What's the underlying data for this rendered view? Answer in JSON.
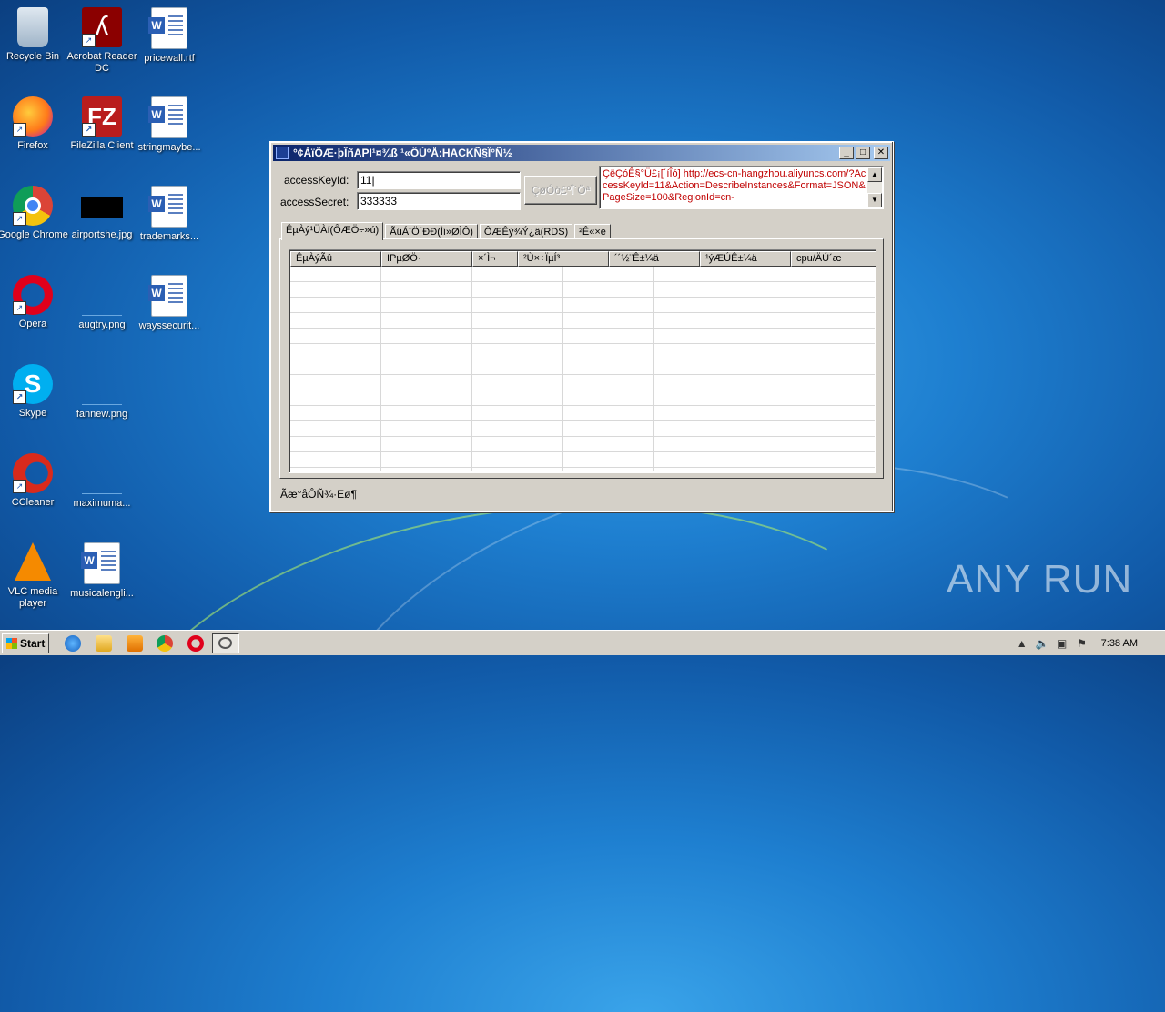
{
  "desktop": {
    "icons": [
      {
        "label": "Recycle Bin"
      },
      {
        "label": "Acrobat Reader DC"
      },
      {
        "label": "pricewall.rtf"
      },
      {
        "label": "Firefox"
      },
      {
        "label": "FileZilla Client"
      },
      {
        "label": "stringmaybe..."
      },
      {
        "label": "Google Chrome"
      },
      {
        "label": "airportshe.jpg"
      },
      {
        "label": "trademarks..."
      },
      {
        "label": "Opera"
      },
      {
        "label": "augtry.png"
      },
      {
        "label": "wayssecurit..."
      },
      {
        "label": "Skype"
      },
      {
        "label": "fannew.png"
      },
      {
        "label": "CCleaner"
      },
      {
        "label": "maximuma..."
      },
      {
        "label": "VLC media player"
      },
      {
        "label": "musicalengli..."
      }
    ]
  },
  "window": {
    "title": "°¢ÀïÔÆ·þÎñAPI¹¤¾ß ¹«ÖÚºÅ:HACKÑ§Ï°Ñ½",
    "access_key_label": "accessKeyId:",
    "access_key_value": "11|",
    "access_secret_label": "accessSecret:",
    "access_secret_value": "333333",
    "query_button": "ÇøÓò£ºÎ´Öª",
    "url_text": "ÇëÇóÊ§°Ü£¡[´íÎó] http://ecs-cn-hangzhou.aliyuncs.com/?AccessKeyId=11&Action=DescribeInstances&Format=JSON&PageSize=100&RegionId=cn-",
    "tabs": [
      {
        "label": "ÊµÀý¹ÜÀí(ÔÆÖ÷»ú)"
      },
      {
        "label": "ÃüÁîÖ´ÐÐ(Ìí»ØÌÔ)"
      },
      {
        "label": "ÔÆÊý¾Ý¿â(RDS)"
      },
      {
        "label": "²Ê«×é"
      }
    ],
    "columns": [
      "ÊµÀýÃû",
      "IPµØÖ·",
      "×´Ì¬",
      "²Ù×÷ÏµÍ³",
      "´´½¨Ê±¼ä",
      "¹ýÆÚÊ±¼ä",
      "cpu/ÄÚ´æ"
    ],
    "status_text": "Ãæ°åÔÑ¾·Eø¶"
  },
  "watermark": "ANY  RUN",
  "taskbar": {
    "start_label": "Start",
    "clock": "7:38 AM"
  }
}
